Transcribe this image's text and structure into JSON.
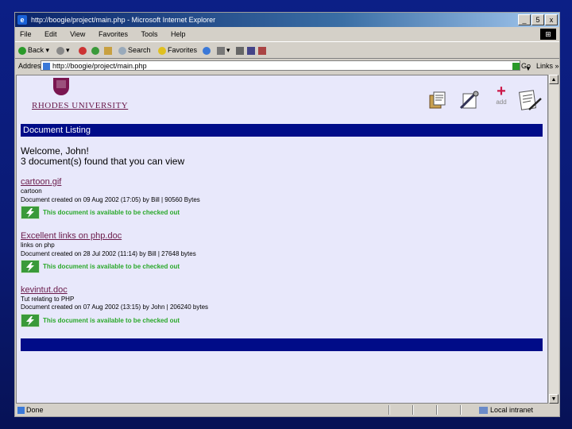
{
  "browser": {
    "title": "http://boogie/project/main.php - Microsoft Internet Explorer",
    "window_buttons": [
      "_",
      "5",
      "x"
    ],
    "menu": [
      "File",
      "Edit",
      "View",
      "Favorites",
      "Tools",
      "Help"
    ],
    "toolbar": {
      "back": "Back",
      "search": "Search",
      "favorites": "Favorites"
    },
    "address_label": "Address",
    "address": "http://boogie/project/main.php",
    "go_label": "Go",
    "links_label": "Links",
    "status": "Done",
    "zone": "Local intranet",
    "logo_glyph": "⊞"
  },
  "page": {
    "university": "RHODES UNIVERSITY",
    "add_label": "add",
    "banner_title": "Document Listing",
    "welcome": "Welcome, John!",
    "count_text": "3 document(s) found that you can view",
    "availability_text": "This document is available to be checked out",
    "documents": [
      {
        "name": "cartoon.gif",
        "description": "cartoon",
        "meta": "Document created on 09 Aug 2002 (17:05) by Bill | 90560 Bytes"
      },
      {
        "name": "Excellent links on php.doc",
        "description": "links on php",
        "meta": "Document created on 28 Jul 2002 (11:14) by Bill | 27648 bytes"
      },
      {
        "name": "kevintut.doc",
        "description": "Tut relating to PHP",
        "meta": "Document created on 07 Aug 2002 (13:15) by John | 206240 bytes"
      }
    ]
  },
  "colors": {
    "banner": "#000c88",
    "link": "#6a1a4a",
    "available": "#2aa82a",
    "add": "#cc1848",
    "background": "#0c1f86"
  }
}
